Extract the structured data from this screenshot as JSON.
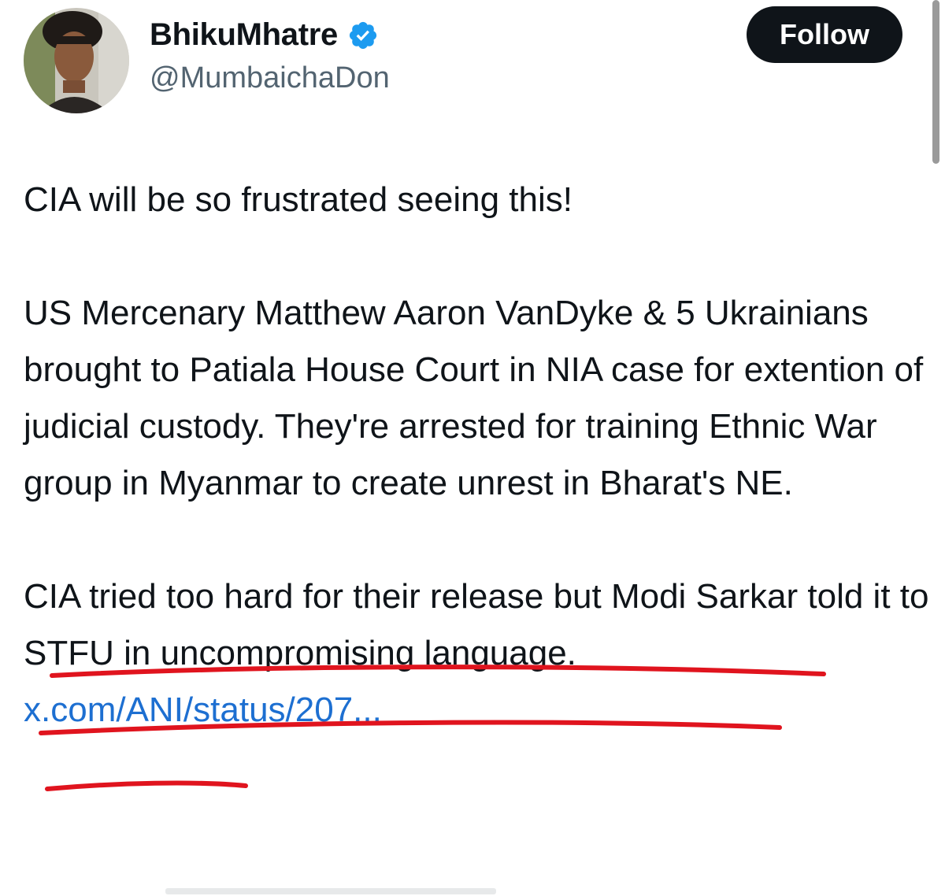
{
  "author": {
    "display_name": "BhikuMhatre",
    "handle": "@MumbaichaDon",
    "verified": true,
    "verified_color": "#1d9bf0"
  },
  "actions": {
    "follow_label": "Follow"
  },
  "tweet": {
    "paragraph_1": "CIA will be so frustrated seeing this!",
    "paragraph_2": "US Mercenary Matthew Aaron VanDyke & 5 Ukrainians brought to Patiala House Court in NIA case for extention of judicial custody. They're arrested for training Ethnic War group in Myanmar to create unrest in Bharat's NE.",
    "paragraph_3": "CIA tried too hard for their release but Modi Sarkar told it to STFU in uncompromising language.",
    "link": "x.com/ANI/status/207..."
  },
  "annotation": {
    "underline_color": "#e0141e"
  },
  "icons": {
    "verified": "verified-badge-icon"
  }
}
